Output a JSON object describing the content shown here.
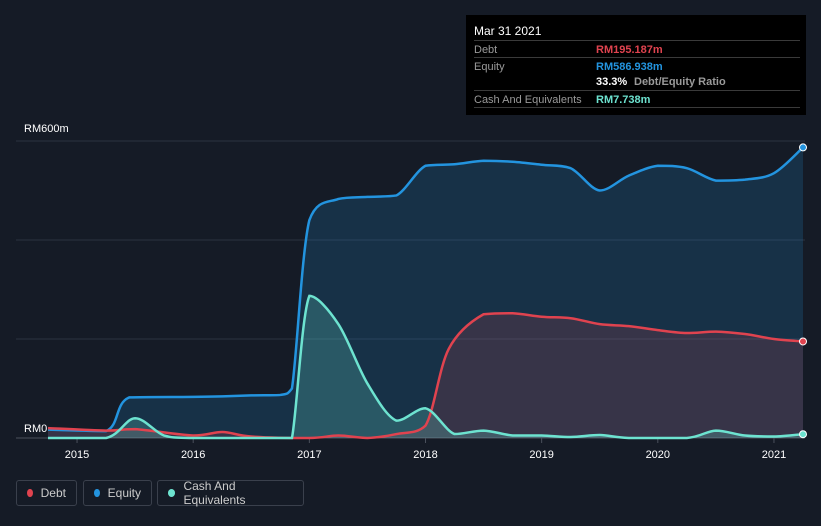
{
  "tooltip": {
    "date": "Mar 31 2021",
    "debt_label": "Debt",
    "debt_value": "RM195.187m",
    "equity_label": "Equity",
    "equity_value": "RM586.938m",
    "ratio_value": "33.3%",
    "ratio_label": "Debt/Equity Ratio",
    "cash_label": "Cash And Equivalents",
    "cash_value": "RM7.738m"
  },
  "legend": [
    {
      "label": "Debt",
      "color": "#e0434f"
    },
    {
      "label": "Equity",
      "color": "#2394df"
    },
    {
      "label": "Cash And Equivalents",
      "color": "#6de3d0"
    }
  ],
  "chart_data": {
    "type": "area",
    "ylim": [
      0,
      600
    ],
    "xlim": [
      2014.75,
      2021.25
    ],
    "y_tick_labels": [
      "RM0",
      "RM600m"
    ],
    "y_gridlines": [
      0,
      200,
      400,
      600
    ],
    "x_ticks": [
      "2015",
      "2016",
      "2017",
      "2018",
      "2019",
      "2020",
      "2021"
    ],
    "series": [
      {
        "name": "Equity",
        "color": "#2394df",
        "x": [
          2014.75,
          2015.25,
          2015.45,
          2016.0,
          2016.25,
          2016.5,
          2016.75,
          2016.85,
          2017.0,
          2017.25,
          2017.5,
          2017.75,
          2018.0,
          2018.25,
          2018.5,
          2018.75,
          2019.0,
          2019.25,
          2019.5,
          2019.75,
          2020.0,
          2020.25,
          2020.5,
          2020.75,
          2021.0,
          2021.25
        ],
        "y": [
          17,
          14,
          82,
          83,
          84,
          86,
          87,
          100,
          440,
          483,
          487,
          490,
          550,
          553,
          560,
          558,
          552,
          545,
          500,
          530,
          550,
          545,
          520,
          522,
          535,
          587
        ]
      },
      {
        "name": "Debt",
        "color": "#e0434f",
        "x": [
          2014.75,
          2015.25,
          2015.5,
          2016.0,
          2016.25,
          2016.5,
          2017.0,
          2017.25,
          2017.5,
          2017.75,
          2018.0,
          2018.2,
          2018.5,
          2018.75,
          2019.0,
          2019.25,
          2019.5,
          2019.75,
          2020.0,
          2020.25,
          2020.5,
          2020.75,
          2021.0,
          2021.25
        ],
        "y": [
          20,
          15,
          18,
          5,
          12,
          3,
          0,
          5,
          0,
          8,
          25,
          180,
          250,
          252,
          245,
          242,
          230,
          226,
          218,
          212,
          215,
          210,
          200,
          195
        ]
      },
      {
        "name": "Cash And Equivalents",
        "color": "#6de3d0",
        "x": [
          2014.75,
          2015.25,
          2015.5,
          2015.75,
          2016.0,
          2016.75,
          2016.85,
          2017.0,
          2017.25,
          2017.5,
          2017.75,
          2018.0,
          2018.25,
          2018.5,
          2018.75,
          2019.0,
          2019.25,
          2019.5,
          2019.75,
          2020.25,
          2020.5,
          2020.75,
          2021.0,
          2021.25
        ],
        "y": [
          0,
          0,
          40,
          5,
          0,
          0,
          0,
          287,
          230,
          110,
          35,
          60,
          8,
          15,
          5,
          5,
          2,
          6,
          0,
          0,
          15,
          5,
          3,
          7.7
        ]
      }
    ]
  }
}
